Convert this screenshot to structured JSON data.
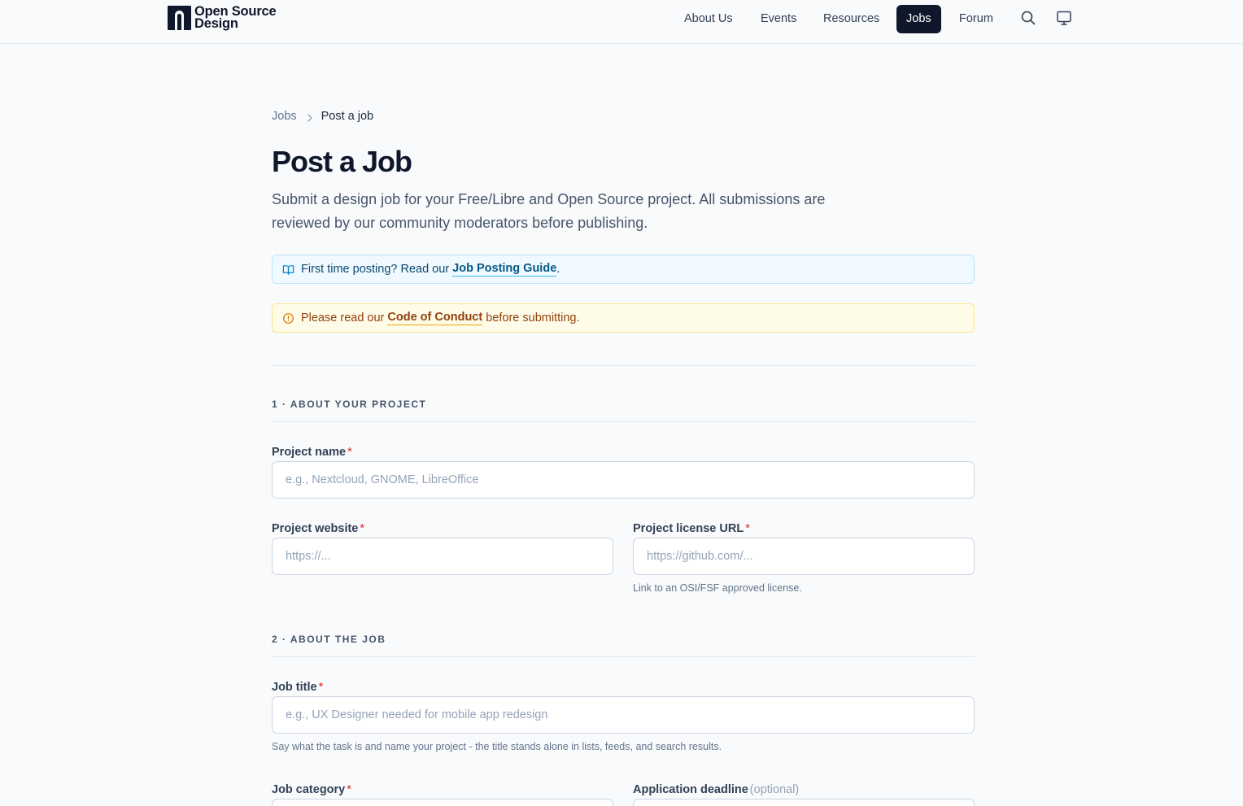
{
  "header": {
    "logo": {
      "line1": "Open Source",
      "line2": "Design"
    },
    "nav": [
      {
        "label": "About Us"
      },
      {
        "label": "Events"
      },
      {
        "label": "Resources"
      },
      {
        "label": "Jobs",
        "active": true
      },
      {
        "label": "Forum"
      }
    ],
    "icons": [
      "search-icon",
      "monitor-icon"
    ]
  },
  "breadcrumb": {
    "parent": "Jobs",
    "current": "Post a job"
  },
  "page": {
    "title": "Post a Job",
    "subtitle": "Submit a design job for your Free/Libre and Open Source project. All submissions are reviewed by our community moderators before publishing."
  },
  "notices": {
    "info": {
      "prefix": "First time posting? Read our ",
      "link": "Job Posting Guide",
      "suffix": ".",
      "icon": "book-open-icon"
    },
    "warn": {
      "prefix": "Please read our ",
      "link": "Code of Conduct",
      "suffix": " before submitting.",
      "icon": "alert-circle-icon"
    }
  },
  "sections": {
    "project": {
      "title": "1 · ABOUT YOUR PROJECT",
      "project_name": {
        "label": "Project name",
        "placeholder": "e.g., Nextcloud, GNOME, LibreOffice"
      },
      "project_website": {
        "label": "Project website",
        "placeholder": "https://..."
      },
      "project_license": {
        "label": "Project license URL",
        "placeholder": "https://github.com/...",
        "help": "Link to an OSI/FSF approved license."
      }
    },
    "job": {
      "title": "2 · ABOUT THE JOB",
      "job_title": {
        "label": "Job title",
        "placeholder": "e.g., UX Designer needed for mobile app redesign",
        "help": "Say what the task is and name your project - the title stands alone in lists, feeds, and search results."
      },
      "job_category": {
        "label": "Job category"
      },
      "deadline": {
        "label": "Application deadline",
        "optional": "(optional)"
      }
    }
  },
  "required_marker": "*",
  "colors": {
    "accent": "#0f172a",
    "required": "#dc2626",
    "info_bg": "#f0f9ff",
    "warn_bg": "#fefce8"
  }
}
